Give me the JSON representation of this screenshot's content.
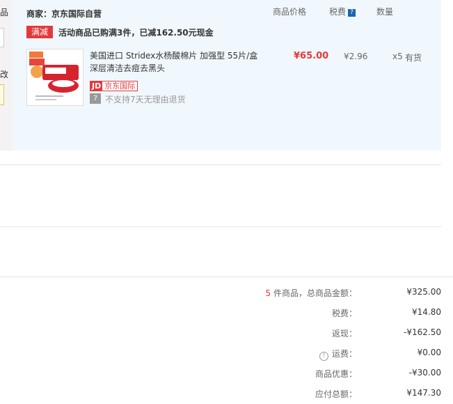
{
  "left_strip": {
    "fragment_top": "品",
    "fragment_mid": "改"
  },
  "order": {
    "merchant_label": "商家：京东国际自营",
    "columns": {
      "price": "商品价格",
      "tax": "税费",
      "qty": "数量"
    },
    "promo": {
      "tag": "满减",
      "text": "活动商品已购满3件，已减162.50元现金"
    },
    "item": {
      "title": "美国进口 Stridex水杨酸棉片 加强型 55片/盒 深层清洁去痘去黑头",
      "badge_jd": "JD",
      "badge_name": "京东国际",
      "return_icon": "7",
      "return_policy": "不支持7天无理由退货",
      "price": "¥65.00",
      "tax": "¥2.96",
      "qty": "x5",
      "stock": "有货"
    }
  },
  "summary": {
    "items_count": "5",
    "items_suffix": " 件商品，总商品金额：",
    "total_value": "¥325.00",
    "tax_label": "税费：",
    "tax_value": "¥14.80",
    "rebate_label": "返现：",
    "rebate_value": "-¥162.50",
    "shipping_label": "运费：",
    "shipping_value": "¥0.00",
    "discount_label": "商品优惠：",
    "discount_value": "-¥30.00",
    "payable_label": "应付总额：",
    "payable_value": "¥147.30"
  },
  "colors": {
    "accent_red": "#e4393c",
    "panel_bg": "#f1f8fd",
    "help_blue": "#1a66b3"
  }
}
